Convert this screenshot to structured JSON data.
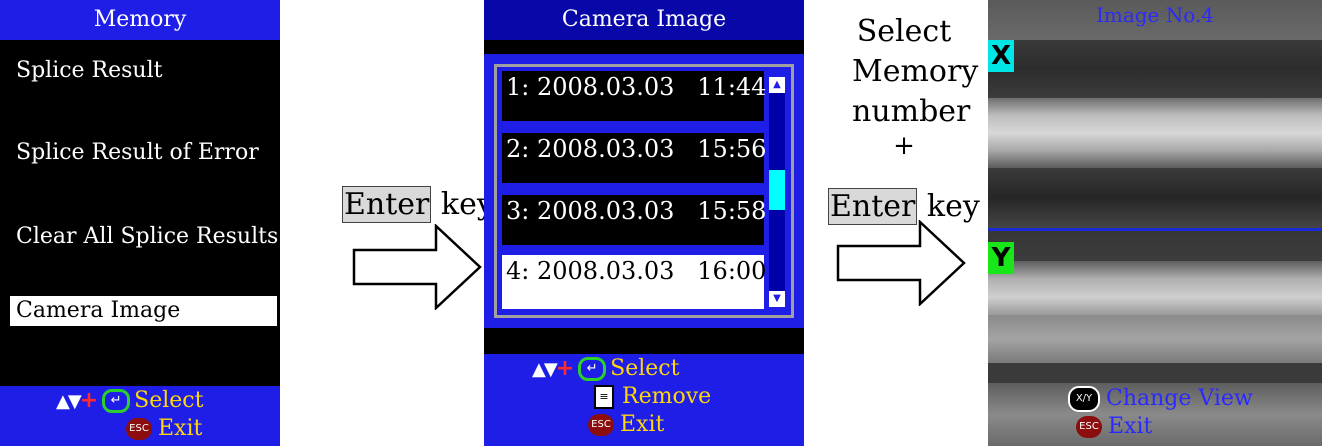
{
  "memory_screen": {
    "title": "Memory",
    "items": [
      "Splice Result",
      "Splice Result of Error",
      "Clear All Splice Results",
      "Camera Image"
    ],
    "selected_index": 3,
    "help": {
      "select_label": "Select",
      "exit_label": "Exit"
    }
  },
  "step1_label": {
    "key": "Enter",
    "suffix": " key"
  },
  "camera_screen": {
    "title": "Camera Image",
    "entries": [
      "1: 2008.03.03   11:44",
      "2: 2008.03.03   15:56",
      "3: 2008.03.03   15:58",
      "4: 2008.03.03   16:00"
    ],
    "selected_index": 3,
    "help": {
      "select_label": "Select",
      "remove_label": "Remove",
      "exit_label": "Exit"
    }
  },
  "step2_label": {
    "line1": "Select",
    "line2": "Memory",
    "line3": "number",
    "line4": "+",
    "key": "Enter",
    "suffix": " key"
  },
  "image_screen": {
    "title": "Image No.4",
    "x_badge": "X",
    "y_badge": "Y",
    "help": {
      "change_view_label": "Change View",
      "exit_label": "Exit"
    }
  },
  "icons": {
    "enter": "enter-icon",
    "esc": "esc-icon",
    "remove": "remove-icon",
    "xy": "xy-toggle-icon",
    "arrows": "up-down-arrows-icon"
  },
  "colors": {
    "screen_blue": "#1e1ee6",
    "help_yellow": "#ffd60a",
    "x_badge": "#00e6e6",
    "y_badge": "#19e619",
    "scroll_thumb": "#00ffff"
  }
}
